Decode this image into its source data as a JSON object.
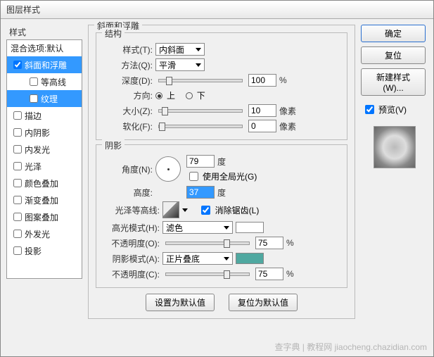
{
  "window": {
    "title": "图层样式"
  },
  "left": {
    "header": "样式",
    "items": [
      {
        "label": "混合选项:默认",
        "checked": null,
        "selected": false
      },
      {
        "label": "斜面和浮雕",
        "checked": true,
        "selected": true
      },
      {
        "label": "等高线",
        "checked": false,
        "selected": false,
        "sub": true
      },
      {
        "label": "纹理",
        "checked": false,
        "selected": false,
        "sub": true,
        "subselected": true
      },
      {
        "label": "描边",
        "checked": false
      },
      {
        "label": "内阴影",
        "checked": false
      },
      {
        "label": "内发光",
        "checked": false
      },
      {
        "label": "光泽",
        "checked": false
      },
      {
        "label": "颜色叠加",
        "checked": false
      },
      {
        "label": "渐变叠加",
        "checked": false
      },
      {
        "label": "图案叠加",
        "checked": false
      },
      {
        "label": "外发光",
        "checked": false
      },
      {
        "label": "投影",
        "checked": false
      }
    ]
  },
  "bevel": {
    "group_label": "斜面和浮雕",
    "structure_label": "结构",
    "style_label": "样式(T):",
    "style_value": "内斜面",
    "technique_label": "方法(Q):",
    "technique_value": "平滑",
    "depth_label": "深度(D):",
    "depth_value": "100",
    "depth_unit": "%",
    "direction_label": "方向:",
    "direction_up": "上",
    "direction_down": "下",
    "size_label": "大小(Z):",
    "size_value": "10",
    "size_unit": "像素",
    "soften_label": "软化(F):",
    "soften_value": "0",
    "soften_unit": "像素"
  },
  "shading": {
    "group_label": "阴影",
    "angle_label": "角度(N):",
    "angle_value": "79",
    "angle_unit": "度",
    "global_light_label": "使用全局光(G)",
    "altitude_label": "高度:",
    "altitude_value": "37",
    "altitude_unit": "度",
    "gloss_contour_label": "光泽等高线:",
    "antialias_label": "消除锯齿(L)",
    "highlight_mode_label": "高光模式(H):",
    "highlight_mode_value": "滤色",
    "highlight_opacity_label": "不透明度(O):",
    "highlight_opacity_value": "75",
    "highlight_opacity_unit": "%",
    "shadow_mode_label": "阴影模式(A):",
    "shadow_mode_value": "正片叠底",
    "shadow_opacity_label": "不透明度(C):",
    "shadow_opacity_value": "75",
    "shadow_opacity_unit": "%"
  },
  "buttons": {
    "ok": "确定",
    "cancel": "复位",
    "new_style": "新建样式(W)...",
    "preview": "预览(V)",
    "make_default": "设置为默认值",
    "reset_default": "复位为默认值"
  },
  "watermark": "查字典 | 教程网 jiaocheng.chazidian.com"
}
